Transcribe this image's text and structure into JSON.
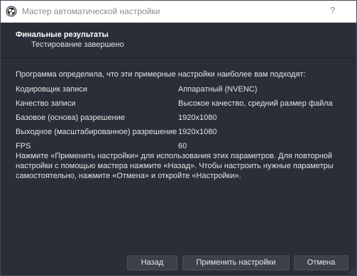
{
  "window": {
    "title": "Мастер автоматической настройки",
    "app_icon": "obs-logo-icon",
    "help_button": "question-icon"
  },
  "header": {
    "title": "Финальные результаты",
    "subtitle": "Тестирование завершено"
  },
  "intro": "Программа определила, что эти примерные настройки наиболее вам подходят:",
  "settings": [
    {
      "label": "Кодировщик записи",
      "value": "Аппаратный (NVENC)"
    },
    {
      "label": "Качество записи",
      "value": "Высокое качество, средний размер файла"
    },
    {
      "label": "Базовое (основа) разрешение",
      "value": "1920x1080"
    },
    {
      "label": "Выходное (масштабированное) разрешение",
      "value": "1920x1080"
    },
    {
      "label": "FPS",
      "value": "60"
    }
  ],
  "note": "Нажмите «Применить настройки» для использования этих параметров. Для повторной настройки с помощью мастера нажмите «Назад». Чтобы настроить нужные параметры самостоятельно, нажмите «Отмена» и откройте «Настройки».",
  "buttons": {
    "back": "Назад",
    "apply": "Применить настройки",
    "cancel": "Отмена"
  },
  "colors": {
    "background": "#2b2e38",
    "titlebar": "#ffffff",
    "button": "#3c404b",
    "text": "#e4e4e4"
  }
}
